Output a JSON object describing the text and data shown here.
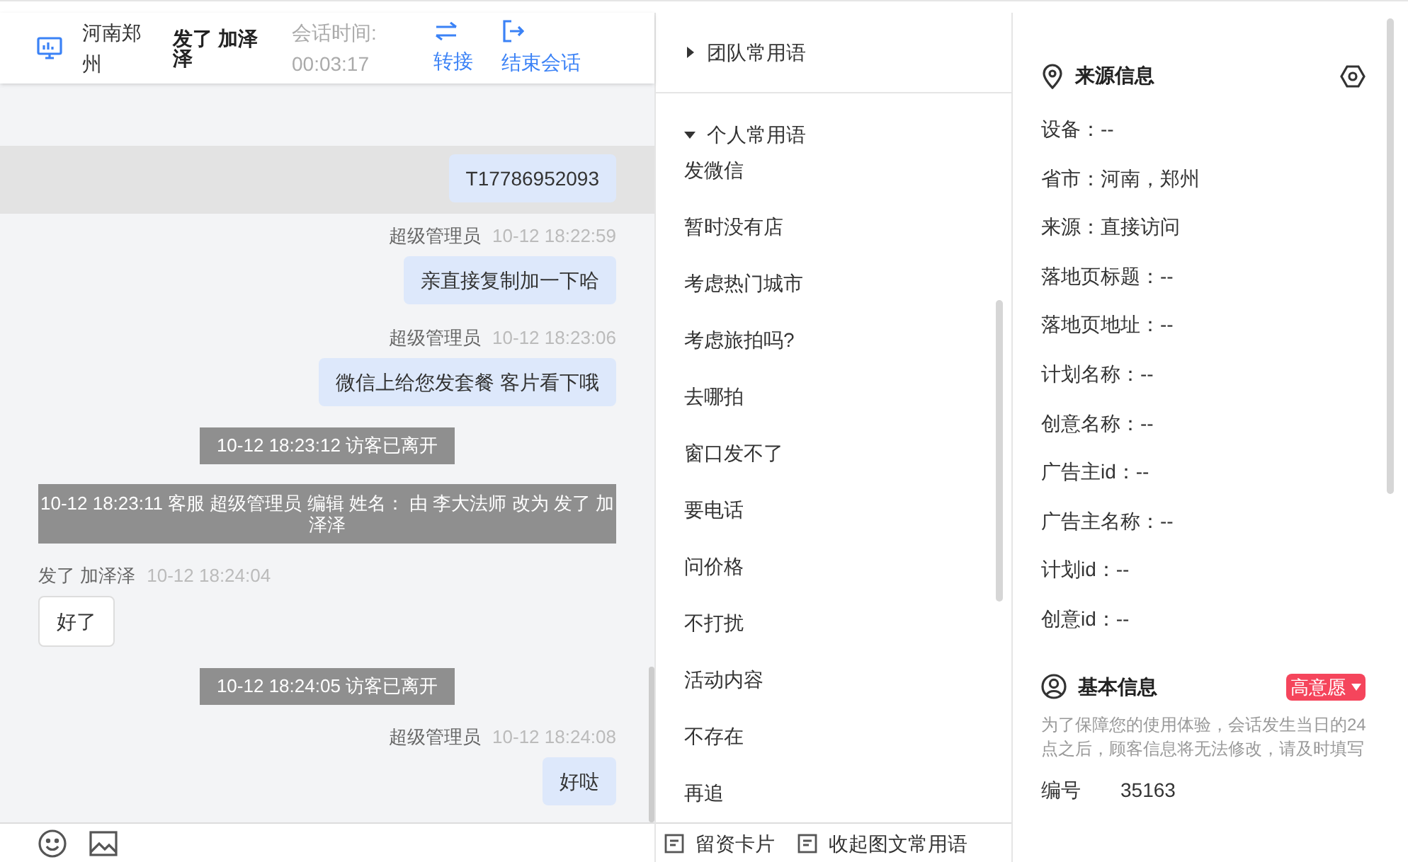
{
  "header": {
    "location": "河南郑州",
    "visitor": "发了 加泽泽",
    "timer_label": "会话时间:",
    "timer": "00:03:17",
    "actions": [
      {
        "kind": "transfer",
        "label": "转接"
      },
      {
        "kind": "end",
        "label": "结束会话"
      }
    ]
  },
  "messages": [
    {
      "kind": "agent",
      "highlighted": true,
      "text": "T17786952093"
    },
    {
      "kind": "agent",
      "highlighted": false,
      "sender": "超级管理员",
      "time": "10-12 18:22:59",
      "text": "亲直接复制加一下哈"
    },
    {
      "kind": "agent",
      "highlighted": false,
      "sender": "超级管理员",
      "time": "10-12 18:23:06",
      "text": "微信上给您发套餐 客片看下哦"
    },
    {
      "kind": "system",
      "text": "10-12 18:23:12 访客已离开"
    },
    {
      "kind": "system_wide",
      "text": "10-12 18:23:11 客服 超级管理员 编辑 姓名： 由 李大法师 改为 发了 加泽泽"
    },
    {
      "kind": "visitor",
      "sender": "发了 加泽泽",
      "time": "10-12 18:24:04",
      "text": "好了"
    },
    {
      "kind": "system",
      "text": "10-12 18:24:05 访客已离开"
    },
    {
      "kind": "agent",
      "highlighted": false,
      "sender": "超级管理员",
      "time": "10-12 18:24:08",
      "text": "好哒"
    }
  ],
  "phrases": {
    "groups": [
      {
        "title": "团队常用语",
        "expanded": false
      },
      {
        "title": "个人常用语",
        "expanded": true,
        "items": [
          "发微信",
          "暂时没有店",
          "考虑热门城市",
          "考虑旅拍吗?",
          "去哪拍",
          "窗口发不了",
          "要电话",
          "问价格",
          "不打扰",
          "活动内容",
          "不存在",
          "再追"
        ]
      }
    ],
    "bottom_actions": [
      "留资卡片",
      "收起图文常用语"
    ]
  },
  "source_info": {
    "title": "来源信息",
    "fields": [
      "设备：--",
      "省市：河南，郑州",
      "来源：直接访问",
      "落地页标题：--",
      "落地页地址：--",
      "计划名称：--",
      "创意名称：--",
      "广告主id：--",
      "广告主名称：--",
      "计划id：--",
      "创意id：--"
    ]
  },
  "basic_info": {
    "title": "基本信息",
    "tag": {
      "label": "高意愿",
      "color": "#f5455c"
    },
    "note": "为了保障您的使用体验，会话发生当日的24点之后，顾客信息将无法修改，请及时填写",
    "fields": [
      {
        "label": "编号",
        "value": "35163"
      }
    ]
  }
}
